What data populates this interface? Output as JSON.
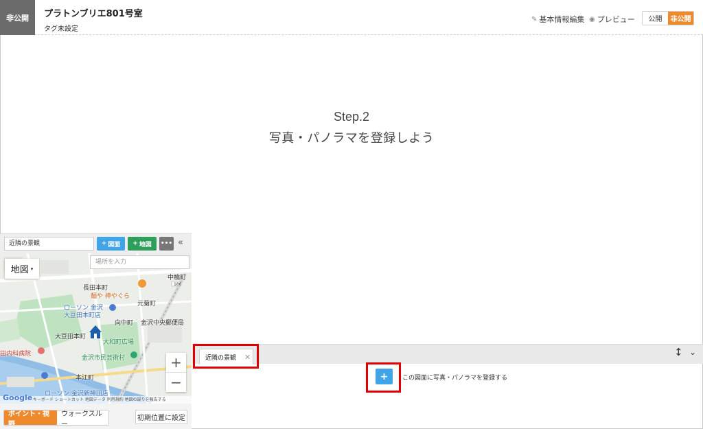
{
  "header": {
    "status_tag": "非公開",
    "title": "プラトンブリエ801号室",
    "tags": "タグ未設定",
    "edit_label": "基本情報編集",
    "preview_label": "プレビュー",
    "publish_toggle": {
      "public": "公開",
      "private": "非公開",
      "selected": "非公開"
    },
    "accent_color": "#ef8a2c"
  },
  "main": {
    "step_line1": "Step.2",
    "step_line2": "写真・パノラマを登録しよう"
  },
  "map_panel": {
    "map_name": "近隣の景観",
    "btn_zumen": "図面",
    "btn_chizu": "地図",
    "btn_more": "•••",
    "map_type": "地図",
    "search_placeholder": "場所を入力",
    "labels": {
      "nagata": "長田本町",
      "menya": "麺や 神やぐら",
      "naka": "中橋町",
      "motokiku": "元菊町",
      "lawson": "ローソン 金沢",
      "lawson2": "大豆田本町店",
      "mukainaka": "向中町",
      "yubin": "金沢中央郵便局",
      "omameda": "大豆田本町",
      "yamato": "大和町広場",
      "mingei": "金沢市民芸術村",
      "hospital": "田内科病院",
      "honkou": "本江町",
      "lawson3": "ローソン 金沢新神田店",
      "road_num": "186"
    },
    "attribution": "キーボード ショートカット   地図データ   利用規約   地図の誤りを報告する",
    "google": "Google",
    "mode_point": "ポイント・視野",
    "mode_walk": "ウォークスルー",
    "reset_label": "初期位置に設定"
  },
  "bottom": {
    "tab_label": "近隣の景観",
    "add_hint": "この図面に写真・パノラマを登録する"
  }
}
